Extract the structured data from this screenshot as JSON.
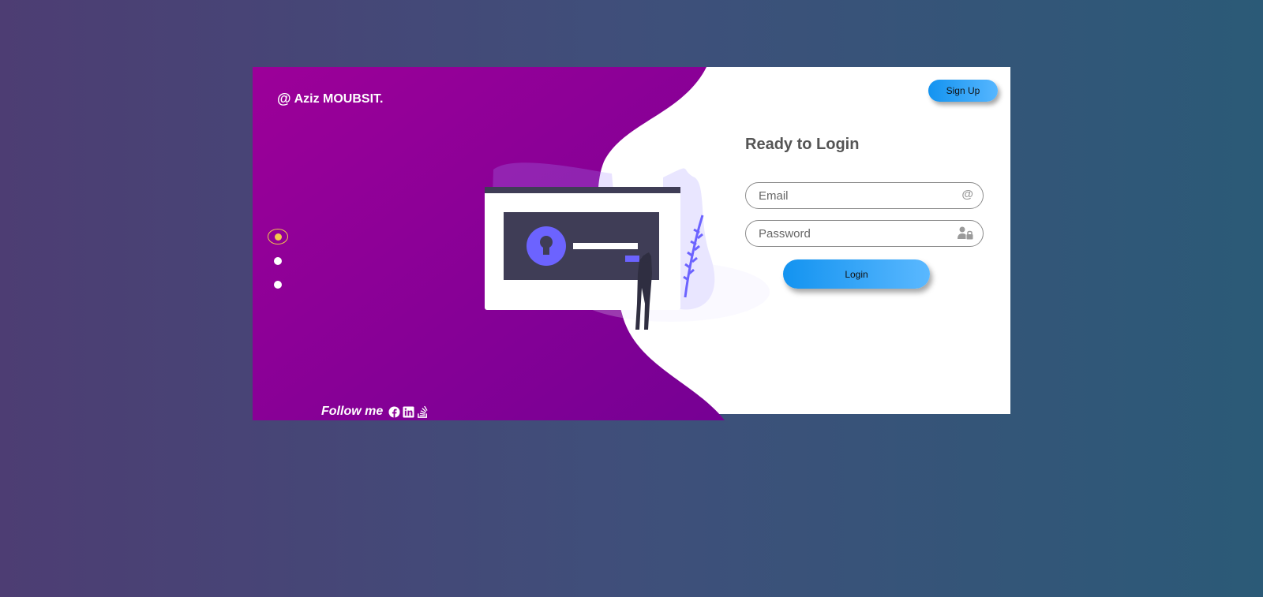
{
  "brand": {
    "at": "@",
    "name": "Aziz MOUBSIT."
  },
  "slider": {
    "active_index": 0,
    "count": 3
  },
  "follow": {
    "label": "Follow me",
    "icons": [
      "facebook-icon",
      "linkedin-icon",
      "stackoverflow-icon"
    ]
  },
  "header": {
    "signup_label": "Sign Up"
  },
  "form": {
    "title": "Ready to Login",
    "email_placeholder": "Email",
    "email_icon": "@",
    "password_placeholder": "Password",
    "login_label": "Login"
  },
  "colors": {
    "accent_gradient_start": "#1393f0",
    "accent_gradient_end": "#56b6ff",
    "panel_purple": "#960096",
    "illustration_accent": "#6c63ff",
    "active_dot": "#f2c94c"
  }
}
